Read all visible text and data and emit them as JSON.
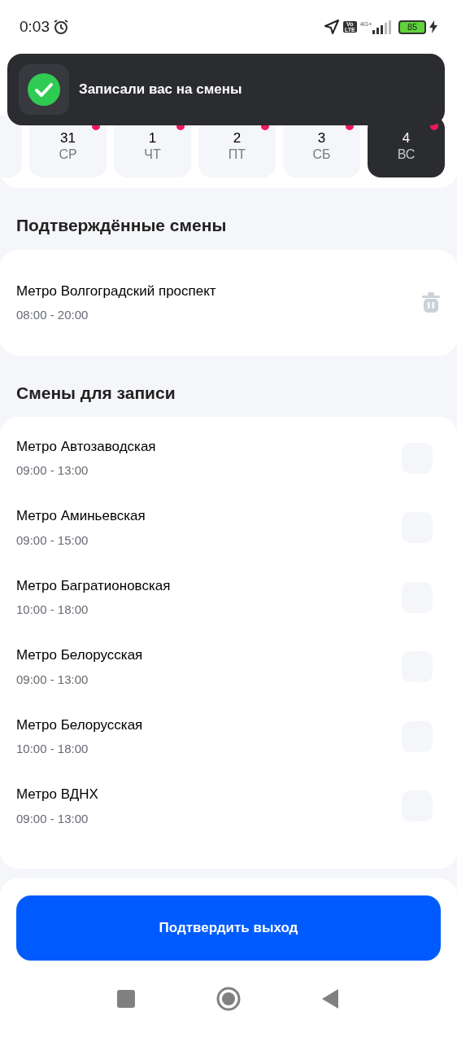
{
  "status_bar": {
    "time": "0:03",
    "volte_top": "Vo",
    "volte_bottom": "LTE",
    "network": "4G+",
    "battery": "85",
    "charging": true
  },
  "toast": {
    "message": "Записали вас на смены"
  },
  "days": [
    {
      "number": "31",
      "weekday": "СР",
      "selected": false,
      "marked": true
    },
    {
      "number": "1",
      "weekday": "ЧТ",
      "selected": false,
      "marked": true
    },
    {
      "number": "2",
      "weekday": "ПТ",
      "selected": false,
      "marked": true
    },
    {
      "number": "3",
      "weekday": "СБ",
      "selected": false,
      "marked": true
    },
    {
      "number": "4",
      "weekday": "ВС",
      "selected": true,
      "marked": true
    }
  ],
  "confirmed": {
    "title": "Подтверждённые смены",
    "shifts": [
      {
        "place": "Метро Волгоградский проспект",
        "time": "08:00 - 20:00"
      }
    ]
  },
  "available": {
    "title": "Смены для записи",
    "shifts": [
      {
        "place": "Метро Автозаводская",
        "time": "09:00 - 13:00",
        "checked": false
      },
      {
        "place": "Метро Аминьевская",
        "time": "09:00 - 15:00",
        "checked": false
      },
      {
        "place": "Метро Багратионовская",
        "time": "10:00 - 18:00",
        "checked": false
      },
      {
        "place": "Метро Белорусская",
        "time": "09:00 - 13:00",
        "checked": false
      },
      {
        "place": "Метро Белорусская",
        "time": "10:00 - 18:00",
        "checked": false
      },
      {
        "place": "Метро ВДНХ",
        "time": "09:00 - 13:00",
        "checked": false
      }
    ]
  },
  "confirm_button": "Подтвердить выход"
}
